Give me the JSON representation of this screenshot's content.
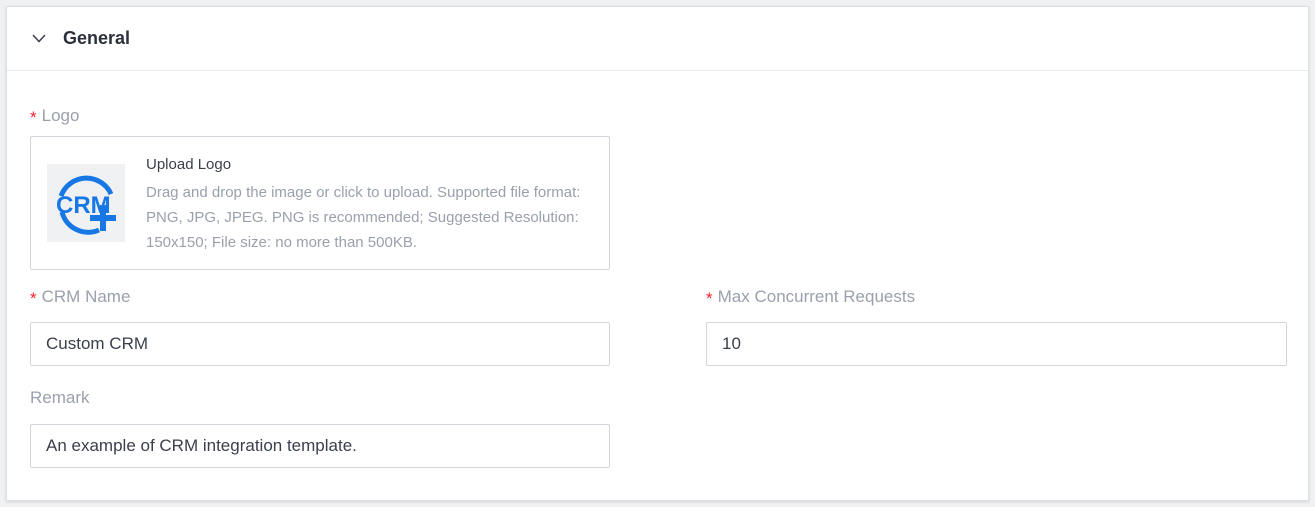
{
  "section": {
    "title": "General",
    "collapse_icon": "chevron-down-icon"
  },
  "logo": {
    "label": "Logo",
    "required_mark": "*",
    "upload_title": "Upload Logo",
    "upload_description": "Drag and drop the image or click to upload. Supported file format: PNG, JPG, JPEG. PNG is recommended; Suggested Resolution: 150x150; File size: no more than 500KB.",
    "preview_text": "CRM",
    "preview_icon": "crm-plus-logo-icon",
    "brand_color": "#1677e5"
  },
  "crm_name": {
    "label": "CRM Name",
    "required_mark": "*",
    "value": "Custom CRM"
  },
  "max_concurrent": {
    "label": "Max Concurrent Requests",
    "required_mark": "*",
    "value": "10"
  },
  "remark": {
    "label": "Remark",
    "value": "An example of CRM integration template."
  },
  "colors": {
    "required": "#f5222d",
    "label": "#9aa0ac",
    "text": "#3a3f4b",
    "border": "#d3d6dc"
  }
}
